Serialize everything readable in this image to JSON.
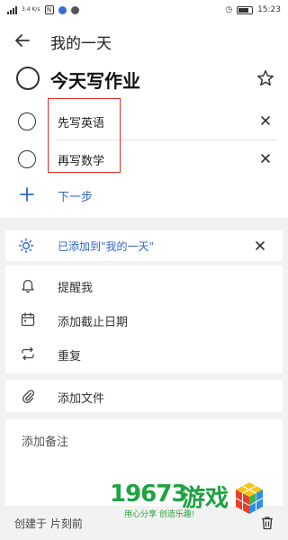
{
  "status_bar": {
    "network": "4G",
    "speed": "3.4 K/s",
    "time": "15:23"
  },
  "header": {
    "title": "我的一天"
  },
  "task": {
    "title": "今天写作业"
  },
  "steps": [
    {
      "label": "先写英语"
    },
    {
      "label": "再写数学"
    }
  ],
  "next_step_label": "下一步",
  "my_day": {
    "label": "已添加到\"我的一天\""
  },
  "options": {
    "remind": "提醒我",
    "due_date": "添加截止日期",
    "repeat": "重复",
    "add_file": "添加文件"
  },
  "note": {
    "placeholder": "添加备注"
  },
  "footer": {
    "created": "创建于 片刻前"
  },
  "watermark": {
    "number": "19673",
    "text": "游戏",
    "slogan": "用心分享  创造乐趣!"
  },
  "colors": {
    "accent": "#2f67c9",
    "highlight": "#e02a2a",
    "watermark": "#1fa342"
  }
}
